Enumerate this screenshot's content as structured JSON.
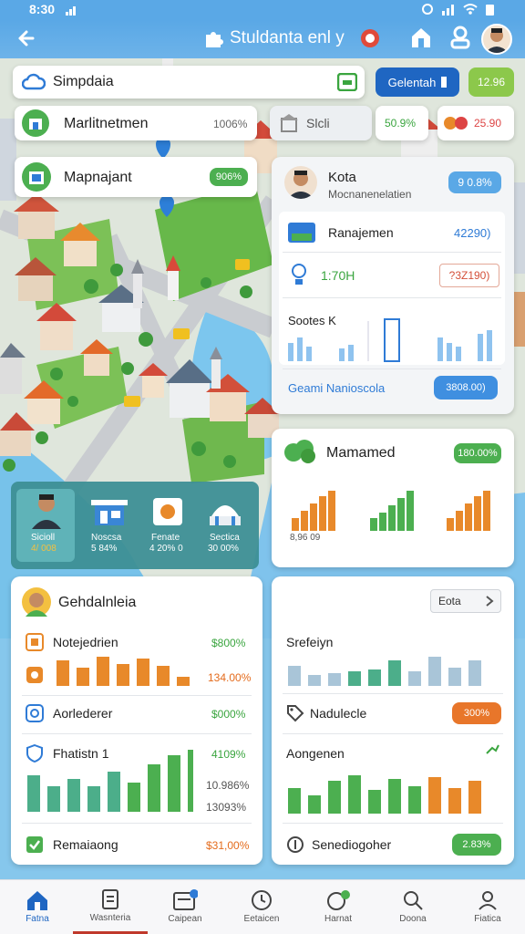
{
  "status_bar": {
    "time": "8:30"
  },
  "header": {
    "title": "Stuldanta enl y"
  },
  "search": {
    "value": "Simpdaia",
    "button_label": "Gelentah",
    "badge": "12.96"
  },
  "row2": {
    "card_label": "Marlitnetmen",
    "card_value": "1006%",
    "mid_label": "Slcli",
    "mid_value": "50.9%",
    "right_value": "25.90"
  },
  "row3": {
    "label": "Mapnajant",
    "value": "906%"
  },
  "kota_panel": {
    "name": "Kota",
    "subtitle": "Mocnanenelatien",
    "badge": "9 0.8%",
    "row1_label": "Ranajemen",
    "row1_value": "42290)",
    "row2_label": "1:70H",
    "row2_value": "?3Z190)",
    "chart_label": "Sootes K",
    "footer_label": "Geami Nanioscola",
    "footer_value": "3808.00)"
  },
  "thumbs": [
    {
      "label": "Sicioll",
      "value": "4/ 008"
    },
    {
      "label": "Noscsa",
      "value": "5 84%"
    },
    {
      "label": "Fenate",
      "value": "4 20% 0"
    },
    {
      "label": "Sectica",
      "value": "30 00%"
    }
  ],
  "mamamed": {
    "title": "Mamamed",
    "badge": "180.00%",
    "axis": "8,96 09"
  },
  "left_panel": {
    "title": "Gehdalnleia",
    "row1_label": "Notejedrien",
    "row1_value": "$800%",
    "row2_value": "134.00%",
    "row3_label": "Aorlederer",
    "row3_value": "$000%",
    "row4_label": "Fhatistn 1",
    "row4_value": "4109%",
    "chart_v1": "10.986%",
    "chart_v2": "13093%",
    "row5_label": "Remaiaong",
    "row5_value": "$31,00%"
  },
  "right_panel": {
    "dropdown": "Eota",
    "label1": "Srefeiyn",
    "label2": "Nadulecle",
    "badge2": "300%",
    "label3": "Aongenen",
    "footer_label": "Senediogoher",
    "footer_badge": "2.83%"
  },
  "bottom_nav": [
    {
      "label": "Fatna"
    },
    {
      "label": "Wasnteria"
    },
    {
      "label": "Caipean"
    },
    {
      "label": "Eetaicen"
    },
    {
      "label": "Harnat"
    },
    {
      "label": "Doona"
    },
    {
      "label": "Fiatica"
    }
  ],
  "colors": {
    "accent_blue": "#1f77d8",
    "green": "#4caf50",
    "orange": "#e8892a",
    "header_bg": "#5aa8e6"
  }
}
